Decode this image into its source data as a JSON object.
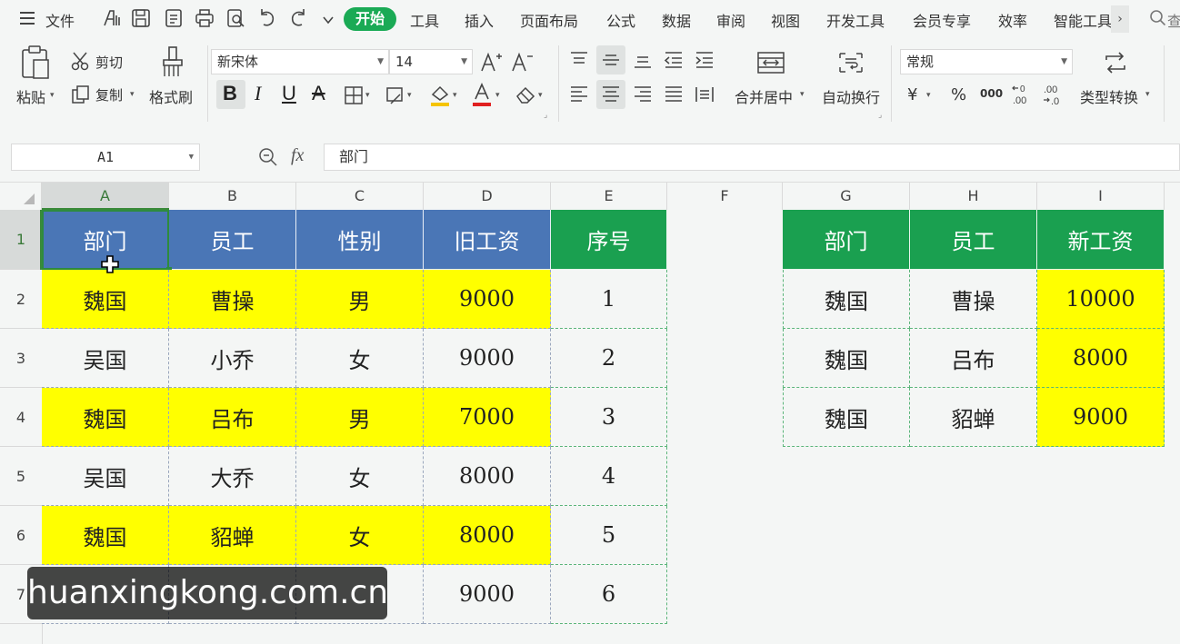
{
  "menu": {
    "file_label": "文件",
    "tabs": [
      "开始",
      "工具",
      "插入",
      "页面布局",
      "公式",
      "数据",
      "审阅",
      "视图",
      "开发工具",
      "会员专享",
      "效率",
      "智能工具"
    ],
    "active_tab": "开始",
    "search_partial": "查"
  },
  "ribbon": {
    "paste": "粘贴",
    "cut": "剪切",
    "copy": "复制",
    "format_painter": "格式刷",
    "font_name": "新宋体",
    "font_size": "14",
    "merge_center": "合并居中",
    "wrap_text": "自动换行",
    "number_format": "常规",
    "currency_symbol": "¥",
    "percent_symbol": "%",
    "thousands_symbol": "000",
    "type_convert": "类型转换",
    "font_color": "#e02020",
    "fill_color": "#f5c400"
  },
  "formula_bar": {
    "cell_ref": "A1",
    "fx": "fx",
    "content": "部门"
  },
  "columns": [
    "A",
    "B",
    "C",
    "D",
    "E",
    "F",
    "G",
    "H",
    "I"
  ],
  "rows": [
    "1",
    "2",
    "3",
    "4",
    "5",
    "6",
    "7"
  ],
  "left_table": {
    "headers": [
      "部门",
      "员工",
      "性别",
      "旧工资",
      "序号"
    ],
    "rows": [
      [
        "魏国",
        "曹操",
        "男",
        "9000",
        "1"
      ],
      [
        "吴国",
        "小乔",
        "女",
        "9000",
        "2"
      ],
      [
        "魏国",
        "吕布",
        "男",
        "7000",
        "3"
      ],
      [
        "吴国",
        "大乔",
        "女",
        "8000",
        "4"
      ],
      [
        "魏国",
        "貂蝉",
        "女",
        "8000",
        "5"
      ],
      [
        "",
        "",
        "",
        "9000",
        "6"
      ]
    ]
  },
  "right_table": {
    "headers": [
      "部门",
      "员工",
      "新工资"
    ],
    "rows": [
      [
        "魏国",
        "曹操",
        "10000"
      ],
      [
        "魏国",
        "吕布",
        "8000"
      ],
      [
        "魏国",
        "貂蝉",
        "9000"
      ]
    ]
  },
  "watermark": "huanxingkong.com.cn",
  "colors": {
    "header_blue": "#4a76b6",
    "header_green": "#1aa050",
    "highlight_yellow": "#ffff00",
    "active_tab_green": "#1aaa55"
  }
}
